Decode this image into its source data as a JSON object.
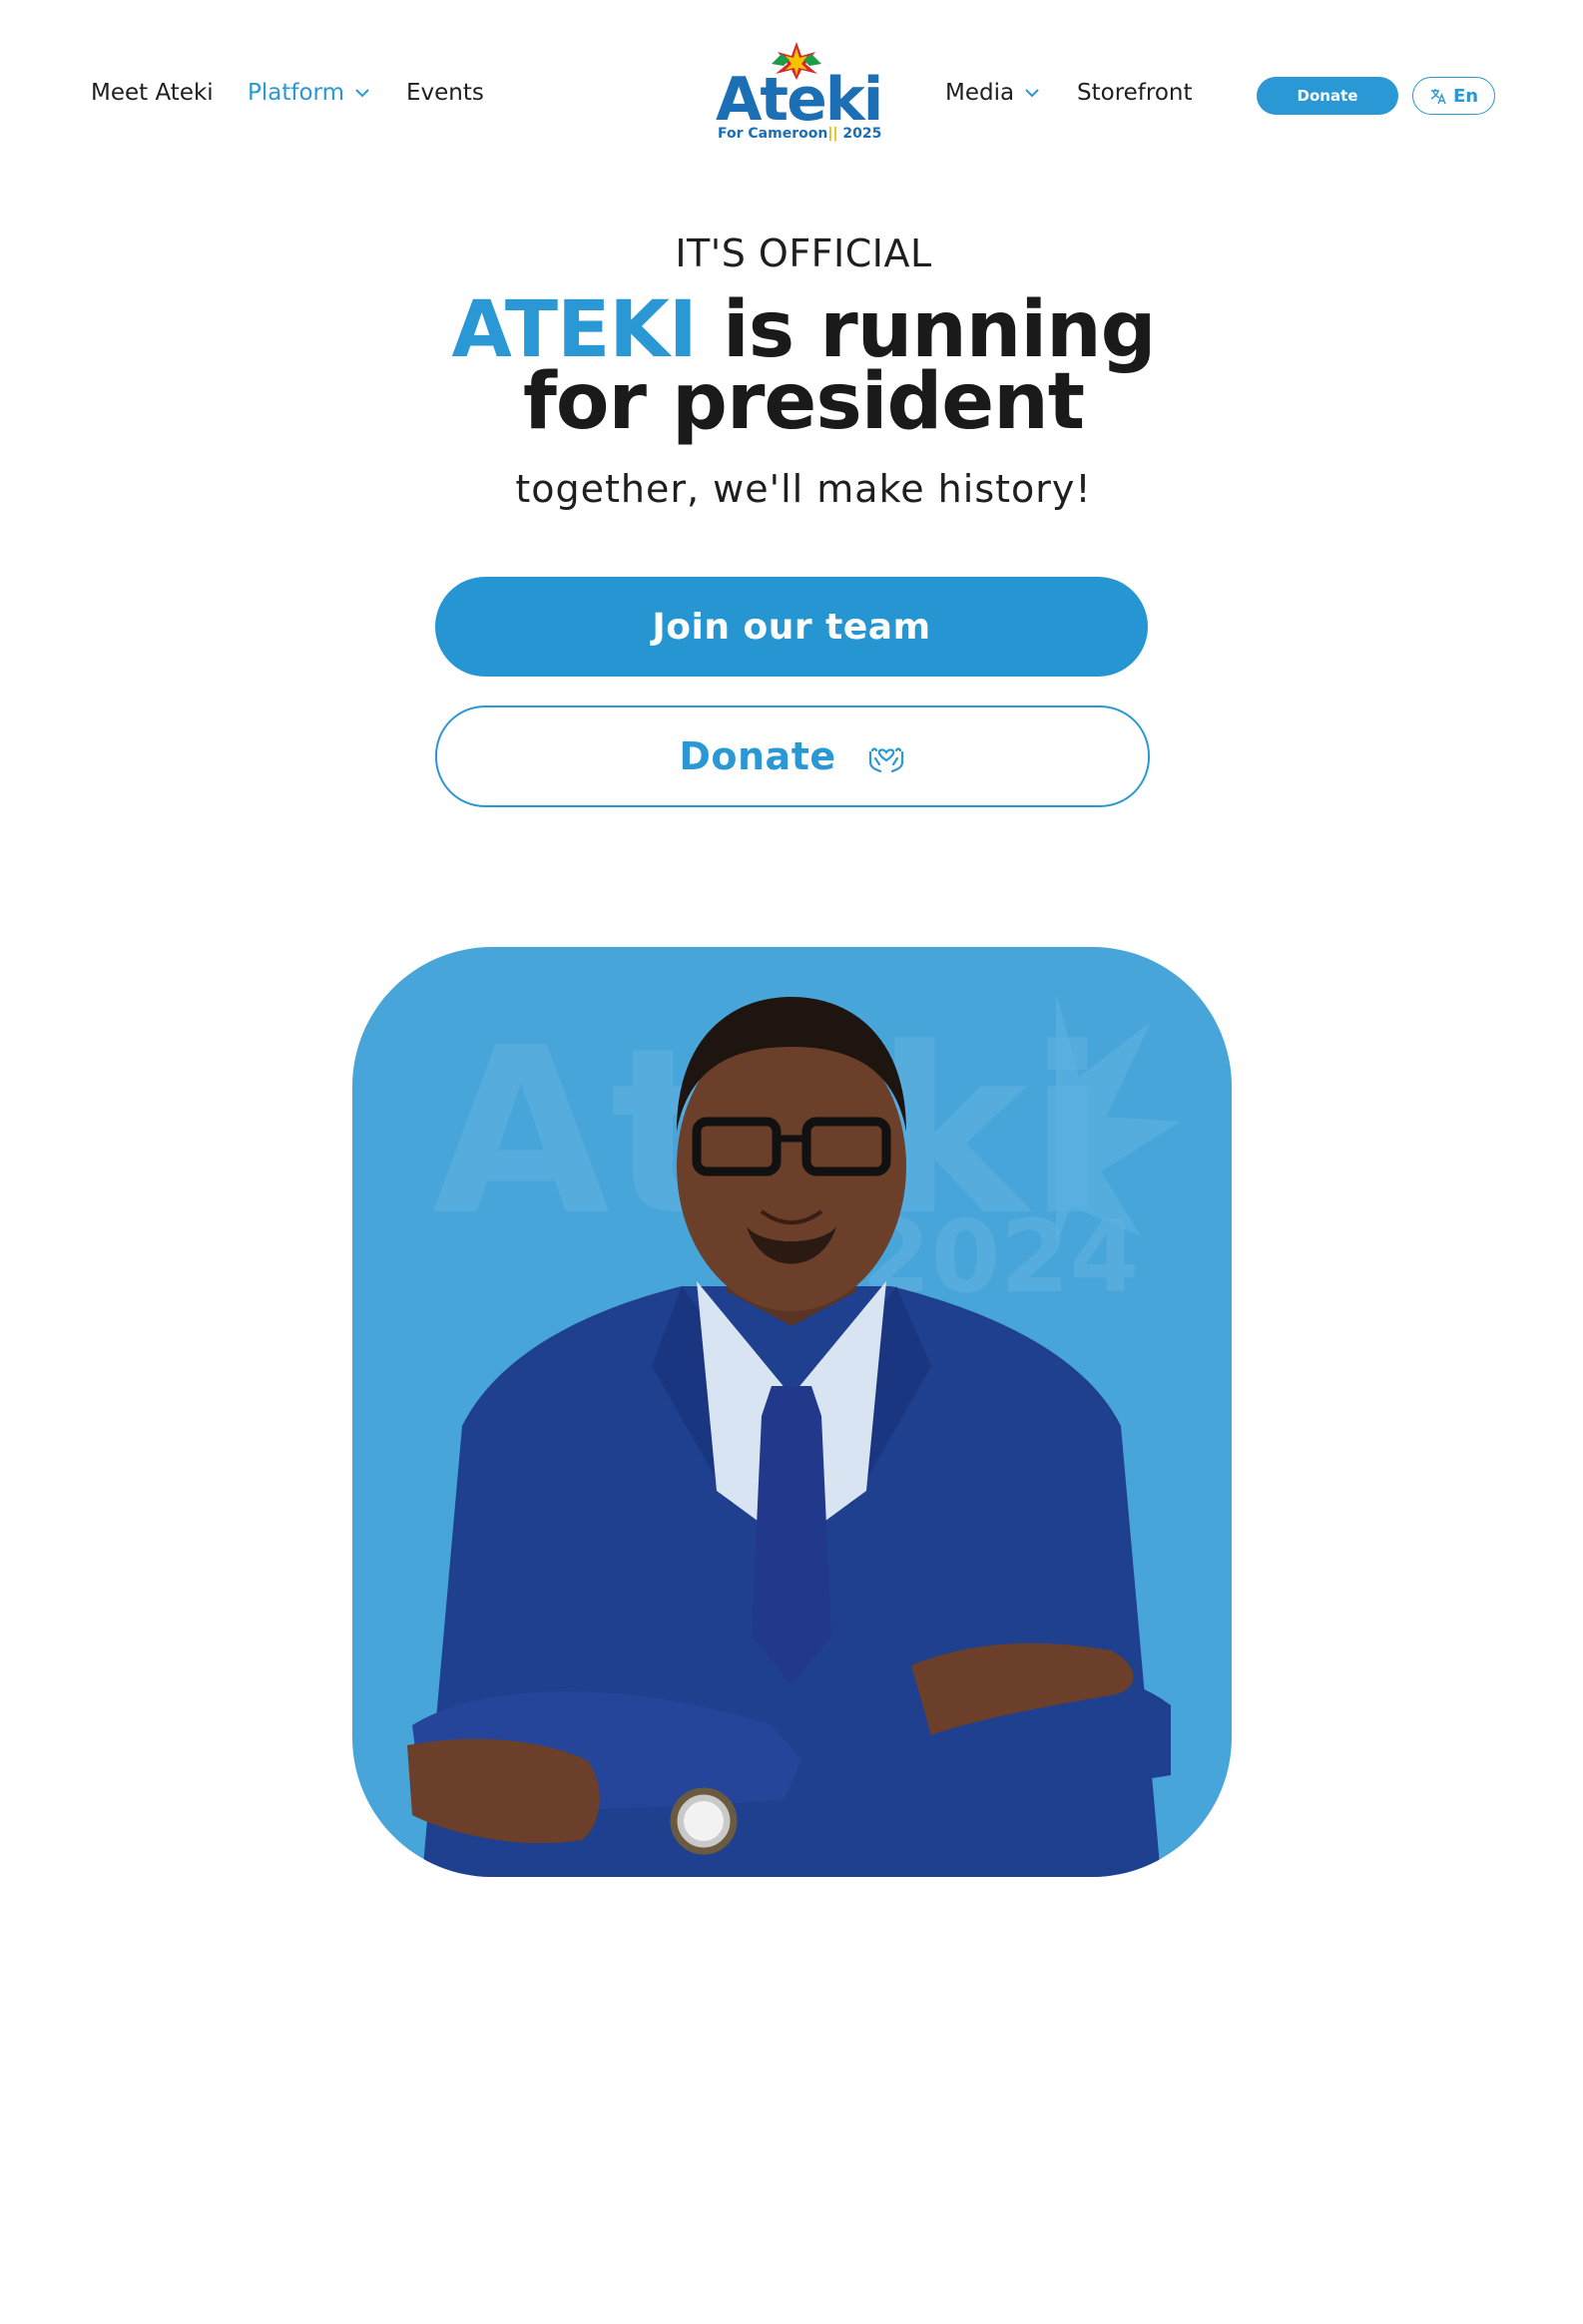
{
  "nav": {
    "left_links": [
      {
        "label": "Meet Ateki",
        "has_dropdown": false,
        "active": false
      },
      {
        "label": "Platform",
        "has_dropdown": true,
        "active": true
      },
      {
        "label": "Events",
        "has_dropdown": false,
        "active": false
      }
    ],
    "right_links": [
      {
        "label": "Media",
        "has_dropdown": true
      },
      {
        "label": "Storefront",
        "has_dropdown": false
      }
    ],
    "logo": {
      "name": "Ateki",
      "tagline": "For Cameroon",
      "year": "2025"
    },
    "donate_label": "Donate",
    "language_label": "En",
    "language_icon": "translate-icon"
  },
  "hero": {
    "eyebrow": "IT'S OFFICIAL",
    "title_accent": "ATEKI",
    "title_rest_line1": " is running",
    "title_line2": "for president",
    "subtitle": "together, we'll make history!",
    "join_label": "Join our team",
    "donate_label": "Donate",
    "donate_icon": "hands-heart-icon"
  },
  "portrait": {
    "watermark_text": "Ateki",
    "watermark_year": "2024"
  },
  "colors": {
    "accent": "#2a98d4",
    "portrait_bg": "#47a5d9",
    "text": "#1a1a1a"
  }
}
